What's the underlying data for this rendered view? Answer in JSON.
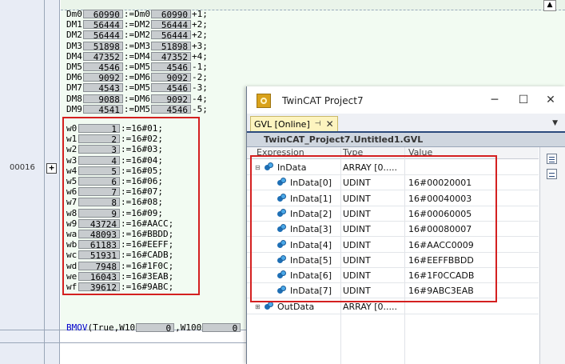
{
  "editor": {
    "network_number": "00016",
    "expand_glyph": "+",
    "top_scroll_glyph": "▲",
    "dm_lines": [
      {
        "a": "Dm0",
        "v1": "60990",
        "op": ":=Dm0",
        "v2": "60990",
        "s": "+1;"
      },
      {
        "a": "DM1",
        "v1": "56444",
        "op": ":=DM2",
        "v2": "56444",
        "s": "+2;"
      },
      {
        "a": "DM2",
        "v1": "56444",
        "op": ":=DM2",
        "v2": "56444",
        "s": "+2;"
      },
      {
        "a": "DM3",
        "v1": "51898",
        "op": ":=DM3",
        "v2": "51898",
        "s": "+3;"
      },
      {
        "a": "DM4",
        "v1": "47352",
        "op": ":=DM4",
        "v2": "47352",
        "s": "+4;"
      },
      {
        "a": "DM5",
        "v1": "4546",
        "op": ":=DM5",
        "v2": "4546",
        "s": "-1;"
      },
      {
        "a": "DM6",
        "v1": "9092",
        "op": ":=DM6",
        "v2": "9092",
        "s": "-2;"
      },
      {
        "a": "DM7",
        "v1": "4543",
        "op": ":=DM5",
        "v2": "4546",
        "s": "-3;"
      },
      {
        "a": "DM8",
        "v1": "9088",
        "op": ":=DM6",
        "v2": "9092",
        "s": "-4;"
      },
      {
        "a": "DM9",
        "v1": "4541",
        "op": ":=DM5",
        "v2": "4546",
        "s": "-5;"
      }
    ],
    "w_lines": [
      {
        "a": "w0",
        "v": "1",
        "s": ":=16#01;"
      },
      {
        "a": "w1",
        "v": "2",
        "s": ":=16#02;"
      },
      {
        "a": "w2",
        "v": "3",
        "s": ":=16#03;"
      },
      {
        "a": "w3",
        "v": "4",
        "s": ":=16#04;"
      },
      {
        "a": "w4",
        "v": "5",
        "s": ":=16#05;"
      },
      {
        "a": "w5",
        "v": "6",
        "s": ":=16#06;"
      },
      {
        "a": "w6",
        "v": "7",
        "s": ":=16#07;"
      },
      {
        "a": "w7",
        "v": "8",
        "s": ":=16#08;"
      },
      {
        "a": "w8",
        "v": "9",
        "s": ":=16#09;"
      },
      {
        "a": "w9",
        "v": "43724",
        "s": ":=16#AACC;"
      },
      {
        "a": "wa",
        "v": "48093",
        "s": ":=16#BBDD;"
      },
      {
        "a": "wb",
        "v": "61183",
        "s": ":=16#EEFF;"
      },
      {
        "a": "wc",
        "v": "51931",
        "s": ":=16#CADB;"
      },
      {
        "a": "wd",
        "v": "7948",
        "s": ":=16#1F0C;"
      },
      {
        "a": "we",
        "v": "16043",
        "s": ":=16#3EAB;"
      },
      {
        "a": "wf",
        "v": "39612",
        "s": ":=16#9ABC;"
      }
    ],
    "bmov": {
      "fn": "BMOV",
      "p1": "(True,W10",
      "v1": "0",
      "p2": ",W100",
      "v2": "0"
    }
  },
  "twincat": {
    "title": "TwinCAT Project7",
    "minimize": "─",
    "maximize": "☐",
    "close": "✕",
    "tab_label": "GVL [Online]",
    "tab_pin": "⊣",
    "tab_close": "✕",
    "dropdown": "▼",
    "path": "TwinCAT_Project7.Untitled1.GVL",
    "headers": {
      "expression": "Expression",
      "type": "Type",
      "value": "Value"
    },
    "rows": [
      {
        "expr": "InData",
        "type": "ARRAY [0.....",
        "value": "",
        "exp": "⊟"
      },
      {
        "expr": "InData[0]",
        "type": "UDINT",
        "value": "16#00020001"
      },
      {
        "expr": "InData[1]",
        "type": "UDINT",
        "value": "16#00040003"
      },
      {
        "expr": "InData[2]",
        "type": "UDINT",
        "value": "16#00060005"
      },
      {
        "expr": "InData[3]",
        "type": "UDINT",
        "value": "16#00080007"
      },
      {
        "expr": "InData[4]",
        "type": "UDINT",
        "value": "16#AACC0009"
      },
      {
        "expr": "InData[5]",
        "type": "UDINT",
        "value": "16#EEFFBBDD"
      },
      {
        "expr": "InData[6]",
        "type": "UDINT",
        "value": "16#1F0CCADB"
      },
      {
        "expr": "InData[7]",
        "type": "UDINT",
        "value": "16#9ABC3EAB"
      },
      {
        "expr": "OutData",
        "type": "ARRAY [0.....",
        "value": "",
        "exp": "⊞"
      }
    ]
  },
  "colors": {
    "highlight_box": "#d42020",
    "accent": "#2b4a7c"
  }
}
